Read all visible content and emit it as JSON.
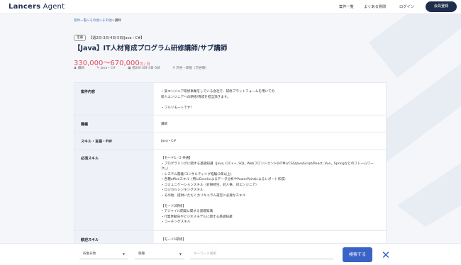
{
  "header": {
    "logo": "Lancers",
    "logo_sub": " Agent",
    "nav": [
      "案件一覧",
      "よくある質問",
      "ログイン"
    ],
    "register": "会員登録"
  },
  "breadcrumb": {
    "items": [
      "案件一覧",
      "その他",
      "その他"
    ],
    "current": "講師"
  },
  "job": {
    "badge": "定番",
    "tags": "【週2日-3日-4日-5日/Java・C#】",
    "title": "【Java】IT人材育成プログラム研修講師/サブ講師",
    "price": "330,000〜670,000",
    "price_unit": "円 / 月",
    "meta": [
      "講師",
      "Java・C#",
      "週2日-3日-4日-5日",
      "渋谷・新宿（渋谷駅）"
    ]
  },
  "table": {
    "rows": [
      {
        "label": "案件内容",
        "value": "・某エンジニア研修事業をしている会社で、研修プラットフォームを用いての\n  新人エンジニアへの研修/育成を担当頂きます。\n\n・フルリモートです！"
      },
      {
        "label": "職種",
        "value": "講師"
      },
      {
        "label": "スキル・言語・FW",
        "value": "Java・C#"
      },
      {
        "label": "必須スキル",
        "value": "【モード1／2 共通】\n・プログラミングに関する基礎知識（Java, C/C++, SQL, Webフロントエンド(HTML/CSS/JavaScript/React, Vue，Springなどのフレームワーク)。）\n・システム開発/コンサルティング経験(3年以上)\n・各種officeスキル（特にExcelによるデータ分析やPowerPointによるレポート作成）\n・コミュニケーションスキル（対研修生、対人事、対エンジニア）\n・ロジカルシンキングスキル\n・その他、提供いただくカリキュラム運営に必要なスキル\n\n【モード2研修】\n・アジャイル開発に関する基礎知識\n・IT業界動向やビジネスモデルに関する基礎知識\n・コーチングスキル"
      },
      {
        "label": "歓迎スキル",
        "value": "【モード1研修】\n・プログラミングの実務経験（3年以上）"
      }
    ]
  },
  "searchbar": {
    "select1": "稼働日数",
    "select2": "職種",
    "keyword_placeholder": "キーワード検索",
    "search_button": "検索する"
  },
  "colors": {
    "navy": "#1e2d4c",
    "price": "#e84a5f",
    "accent": "#3a63c8"
  }
}
